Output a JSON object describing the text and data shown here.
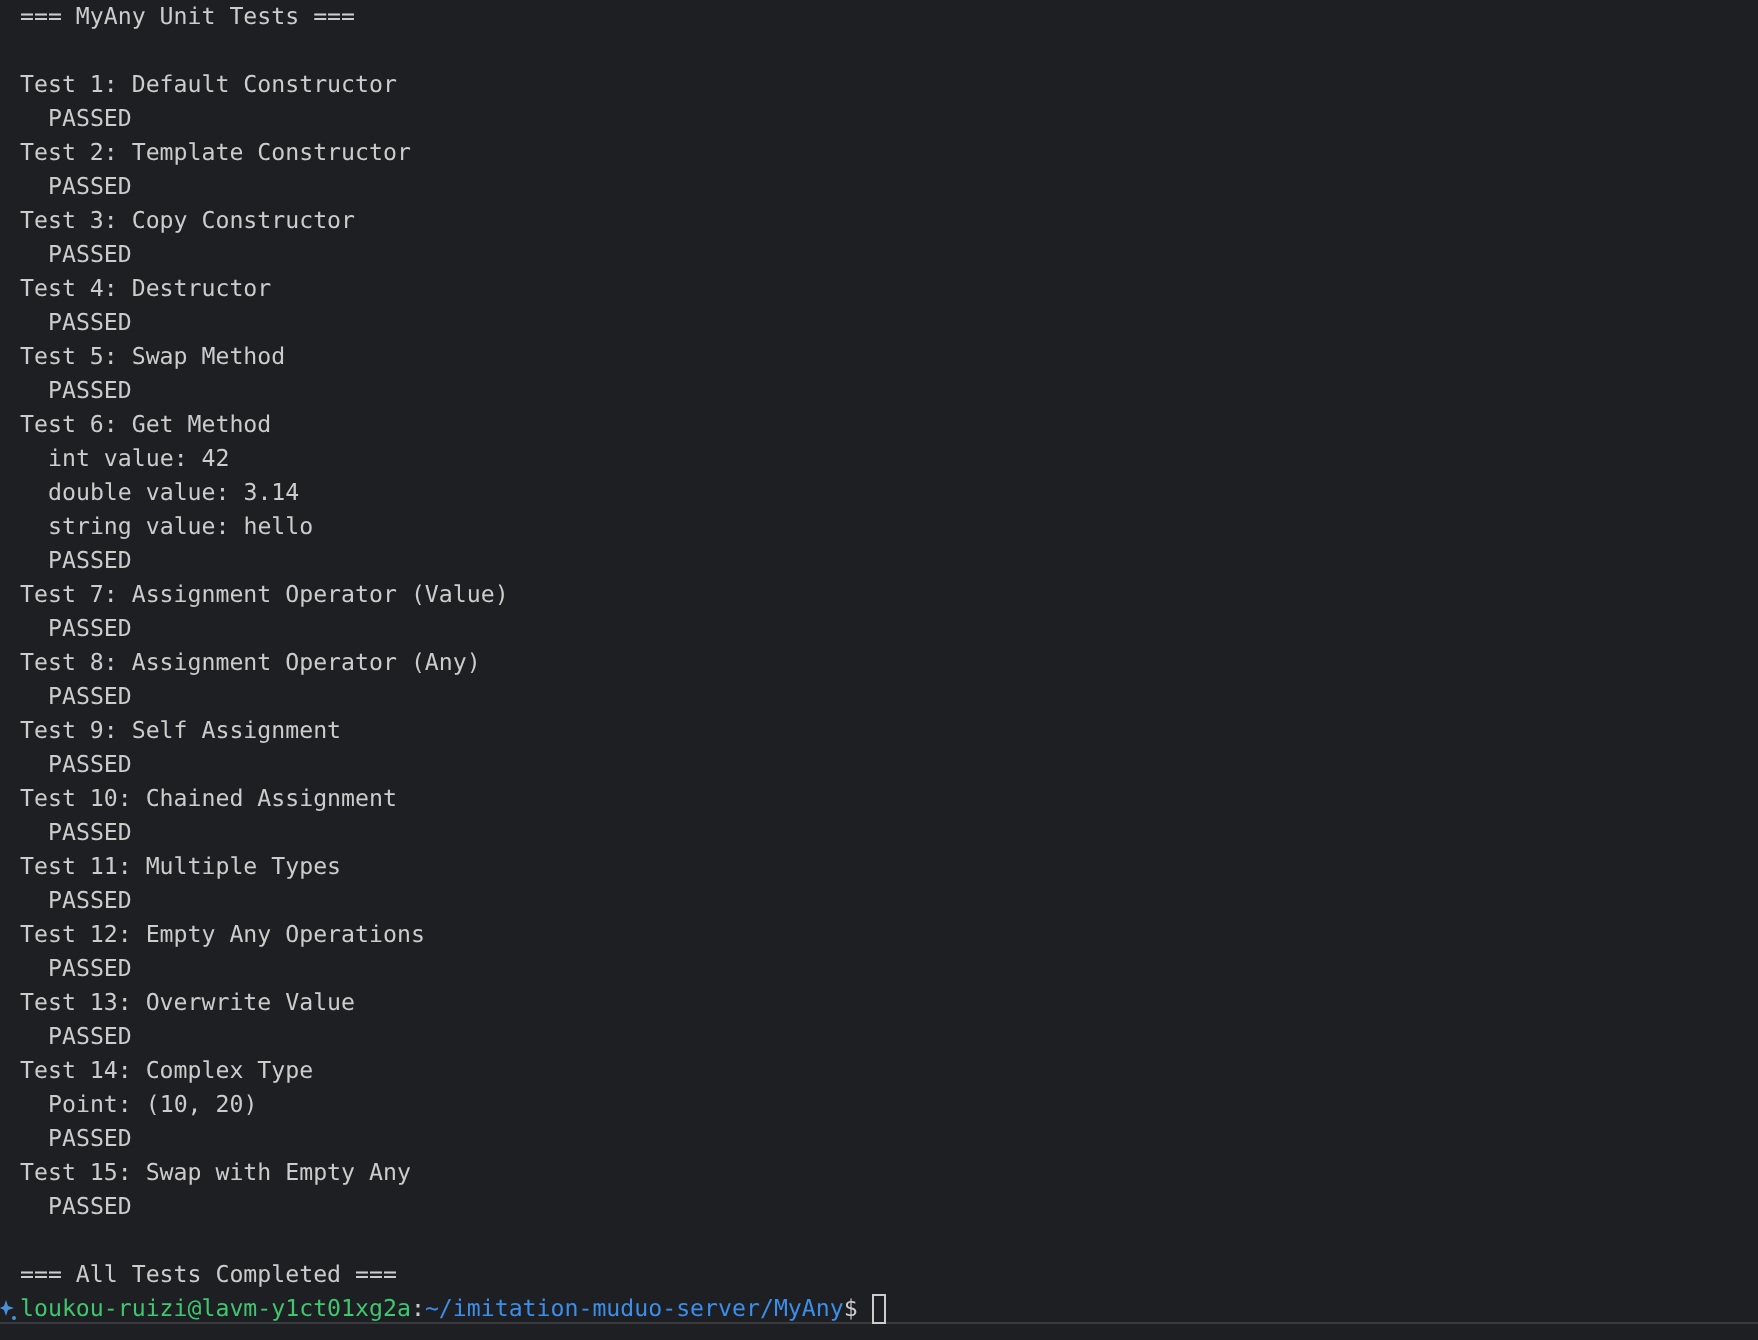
{
  "terminal": {
    "lines": [
      {
        "kind": "header",
        "text": "=== MyAny Unit Tests ==="
      },
      {
        "kind": "blank"
      },
      {
        "kind": "test",
        "text": "Test 1: Default Constructor"
      },
      {
        "kind": "result",
        "text": "PASSED"
      },
      {
        "kind": "test",
        "text": "Test 2: Template Constructor"
      },
      {
        "kind": "result",
        "text": "PASSED"
      },
      {
        "kind": "test",
        "text": "Test 3: Copy Constructor"
      },
      {
        "kind": "result",
        "text": "PASSED"
      },
      {
        "kind": "test",
        "text": "Test 4: Destructor"
      },
      {
        "kind": "result",
        "text": "PASSED"
      },
      {
        "kind": "test",
        "text": "Test 5: Swap Method"
      },
      {
        "kind": "result",
        "text": "PASSED"
      },
      {
        "kind": "test",
        "text": "Test 6: Get Method"
      },
      {
        "kind": "detail",
        "text": "int value: 42"
      },
      {
        "kind": "detail",
        "text": "double value: 3.14"
      },
      {
        "kind": "detail",
        "text": "string value: hello"
      },
      {
        "kind": "result",
        "text": "PASSED"
      },
      {
        "kind": "test",
        "text": "Test 7: Assignment Operator (Value)"
      },
      {
        "kind": "result",
        "text": "PASSED"
      },
      {
        "kind": "test",
        "text": "Test 8: Assignment Operator (Any)"
      },
      {
        "kind": "result",
        "text": "PASSED"
      },
      {
        "kind": "test",
        "text": "Test 9: Self Assignment"
      },
      {
        "kind": "result",
        "text": "PASSED"
      },
      {
        "kind": "test",
        "text": "Test 10: Chained Assignment"
      },
      {
        "kind": "result",
        "text": "PASSED"
      },
      {
        "kind": "test",
        "text": "Test 11: Multiple Types"
      },
      {
        "kind": "result",
        "text": "PASSED"
      },
      {
        "kind": "test",
        "text": "Test 12: Empty Any Operations"
      },
      {
        "kind": "result",
        "text": "PASSED"
      },
      {
        "kind": "test",
        "text": "Test 13: Overwrite Value"
      },
      {
        "kind": "result",
        "text": "PASSED"
      },
      {
        "kind": "test",
        "text": "Test 14: Complex Type"
      },
      {
        "kind": "detail",
        "text": "Point: (10, 20)"
      },
      {
        "kind": "result",
        "text": "PASSED"
      },
      {
        "kind": "test",
        "text": "Test 15: Swap with Empty Any"
      },
      {
        "kind": "result",
        "text": "PASSED"
      },
      {
        "kind": "blank"
      },
      {
        "kind": "header",
        "text": "=== All Tests Completed ==="
      }
    ],
    "prompt": {
      "user_host": "loukou-ruizi@lavm-y1ct01xg2a",
      "separator": ":",
      "path": "~/imitation-muduo-server/MyAny",
      "symbol": "$"
    }
  }
}
